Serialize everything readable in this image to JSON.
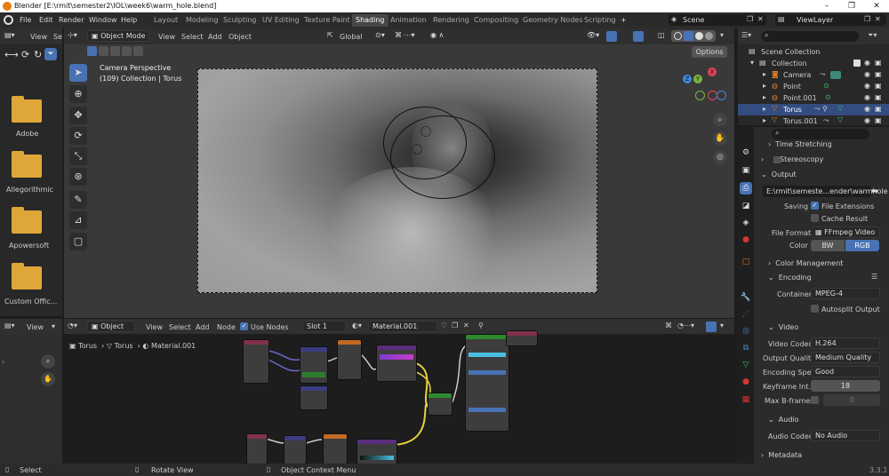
{
  "window": {
    "title": "Blender [E:\\rmit\\semester2\\IOL\\week6\\warm_hole.blend]",
    "minimize": "–",
    "maximize": "❐",
    "close": "✕"
  },
  "menu": [
    "File",
    "Edit",
    "Render",
    "Window",
    "Help"
  ],
  "workspaces": [
    "Layout",
    "Modeling",
    "Sculpting",
    "UV Editing",
    "Texture Paint",
    "Shading",
    "Animation",
    "Rendering",
    "Compositing",
    "Geometry Nodes",
    "Scripting"
  ],
  "active_workspace": "Shading",
  "add_workspace": "+",
  "scene": {
    "name": "Scene",
    "view_layer": "ViewLayer"
  },
  "file_browser": {
    "header": [
      "View",
      "Se"
    ],
    "folders": [
      "Adobe",
      "Allegorithmic",
      "Apowersoft",
      "Custom Offic..."
    ]
  },
  "viewport": {
    "mode": "Object Mode",
    "menus": [
      "View",
      "Select",
      "Add",
      "Object"
    ],
    "transform": "Global",
    "options": "Options",
    "info_line1": "Camera Perspective",
    "info_line2": "(109) Collection | Torus",
    "gizmo": {
      "x": "X",
      "y": "Y",
      "z": "Z"
    }
  },
  "node_editor": {
    "editor_type": "Object",
    "menus": [
      "View",
      "Select",
      "Add",
      "Node"
    ],
    "use_nodes": "Use Nodes",
    "slot": "Slot 1",
    "material": "Material.001",
    "breadcrumb": [
      "Torus",
      "Torus",
      "Material.001"
    ]
  },
  "left_small": {
    "view": "View"
  },
  "outliner": {
    "search_placeholder": "",
    "root": "Scene Collection",
    "collection": "Collection",
    "items": [
      {
        "name": "Camera",
        "selected": false
      },
      {
        "name": "Point",
        "selected": false
      },
      {
        "name": "Point.001",
        "selected": false
      },
      {
        "name": "Torus",
        "selected": true
      },
      {
        "name": "Torus.001",
        "selected": false
      }
    ]
  },
  "properties": {
    "time_stretching": "Time Stretching",
    "stereoscopy": "Stereoscopy",
    "output": "Output",
    "path": "E:\\rmit\\semeste...ender\\warmhole",
    "saving_label": "Saving",
    "file_extensions": "File Extensions",
    "cache_result": "Cache Result",
    "file_format_label": "File Format",
    "file_format": "FFmpeg Video",
    "color_label": "Color",
    "color_bw": "BW",
    "color_rgb": "RGB",
    "color_management": "Color Management",
    "encoding": "Encoding",
    "container_label": "Container",
    "container": "MPEG-4",
    "autosplit": "Autosplit Output",
    "video": "Video",
    "video_codec_label": "Video Codec",
    "video_codec": "H.264",
    "output_quality_label": "Output Quality",
    "output_quality": "Medium Quality",
    "encoding_speed_label": "Encoding Spe...",
    "encoding_speed": "Good",
    "keyframe_label": "Keyframe Int...",
    "keyframe": "18",
    "max_bframes_label": "Max B-frames",
    "max_bframes": "0",
    "audio": "Audio",
    "audio_codec_label": "Audio Codec",
    "audio_codec": "No Audio",
    "metadata": "Metadata"
  },
  "status_bar": {
    "select": "Select",
    "rotate": "Rotate View",
    "context": "Object Context Menu",
    "version": "3.3.1"
  },
  "colors": {
    "accent": "#4772b3",
    "selected_row": "#334d80"
  }
}
